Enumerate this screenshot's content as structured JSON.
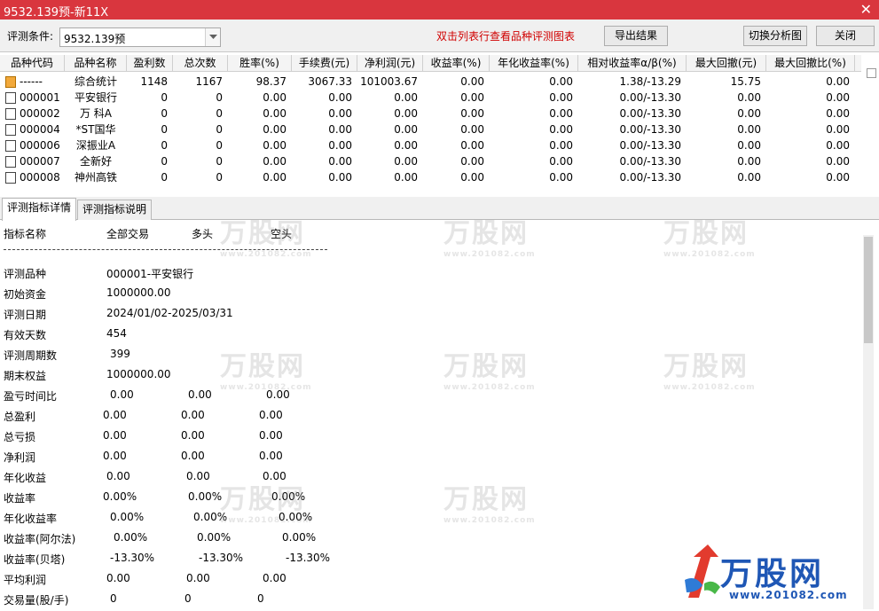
{
  "window": {
    "title": "9532.139预-新11X"
  },
  "toolbar": {
    "condition_label": "评测条件:",
    "condition_value": "9532.139预",
    "hint": "双击列表行查看品种评测图表",
    "export_label": "导出结果",
    "switch_label": "切换分析图",
    "close_label": "关闭"
  },
  "grid": {
    "headers": [
      "品种代码",
      "品种名称",
      "盈利数",
      "总次数",
      "胜率(%)",
      "手续费(元)",
      "净利润(元)",
      "收益率(%)",
      "年化收益率(%)",
      "相对收益率α/β(%)",
      "最大回撤(元)",
      "最大回撤比(%)"
    ],
    "rows": [
      [
        "------",
        "综合统计",
        "1148",
        "1167",
        "98.37",
        "3067.33",
        "101003.67",
        "0.00",
        "0.00",
        "1.38/-13.29",
        "15.75",
        "0.00"
      ],
      [
        "000001",
        "平安银行",
        "0",
        "0",
        "0.00",
        "0.00",
        "0.00",
        "0.00",
        "0.00",
        "0.00/-13.30",
        "0.00",
        "0.00"
      ],
      [
        "000002",
        "万 科A",
        "0",
        "0",
        "0.00",
        "0.00",
        "0.00",
        "0.00",
        "0.00",
        "0.00/-13.30",
        "0.00",
        "0.00"
      ],
      [
        "000004",
        "*ST国华",
        "0",
        "0",
        "0.00",
        "0.00",
        "0.00",
        "0.00",
        "0.00",
        "0.00/-13.30",
        "0.00",
        "0.00"
      ],
      [
        "000006",
        "深振业A",
        "0",
        "0",
        "0.00",
        "0.00",
        "0.00",
        "0.00",
        "0.00",
        "0.00/-13.30",
        "0.00",
        "0.00"
      ],
      [
        "000007",
        "全新好",
        "0",
        "0",
        "0.00",
        "0.00",
        "0.00",
        "0.00",
        "0.00",
        "0.00/-13.30",
        "0.00",
        "0.00"
      ],
      [
        "000008",
        "神州高铁",
        "0",
        "0",
        "0.00",
        "0.00",
        "0.00",
        "0.00",
        "0.00",
        "0.00/-13.30",
        "0.00",
        "0.00"
      ]
    ]
  },
  "tabs": [
    "评测指标详情",
    "评测指标说明"
  ],
  "detail": {
    "headers": [
      "指标名称",
      "全部交易",
      "多头",
      "空头"
    ],
    "separator": "------------------------------------------------------------",
    "info": [
      {
        "label": "评测品种",
        "value": "000001-平安银行"
      },
      {
        "label": "初始资金",
        "value": "1000000.00"
      },
      {
        "label": "评测日期",
        "value": "2024/01/02-2025/03/31"
      },
      {
        "label": "有效天数",
        "value": "454"
      },
      {
        "label": "评测周期数",
        "value": "399"
      },
      {
        "label": "期末权益",
        "value": "1000000.00"
      }
    ],
    "metrics": [
      {
        "label": "盈亏时间比",
        "all": "0.00",
        "long": "0.00",
        "short": "0.00"
      },
      {
        "label": "总盈利",
        "all": "0.00",
        "long": "0.00",
        "short": "0.00"
      },
      {
        "label": "总亏损",
        "all": "0.00",
        "long": "0.00",
        "short": "0.00"
      },
      {
        "label": "净利润",
        "all": "0.00",
        "long": "0.00",
        "short": "0.00"
      },
      {
        "label": "年化收益",
        "all": "0.00",
        "long": "0.00",
        "short": "0.00"
      },
      {
        "label": "收益率",
        "all": "0.00%",
        "long": "0.00%",
        "short": "0.00%"
      },
      {
        "label": "年化收益率",
        "all": "0.00%",
        "long": "0.00%",
        "short": "0.00%"
      },
      {
        "label": "收益率(阿尔法)",
        "all": "0.00%",
        "long": "0.00%",
        "short": "0.00%"
      },
      {
        "label": "收益率(贝塔)",
        "all": "-13.30%",
        "long": "-13.30%",
        "short": "-13.30%"
      },
      {
        "label": "平均利润",
        "all": "0.00",
        "long": "0.00",
        "short": "0.00"
      },
      {
        "label": "交易量(股/手)",
        "all": "0",
        "long": "0",
        "short": "0"
      }
    ]
  },
  "watermark": {
    "text": "万股网",
    "url": "www.201082.com"
  },
  "logo": {
    "name": "万股网",
    "url": "www.201082.com"
  },
  "colors": {
    "titlebar": "#d9363e",
    "hint": "#d00000",
    "brand": "#1f57b5"
  }
}
